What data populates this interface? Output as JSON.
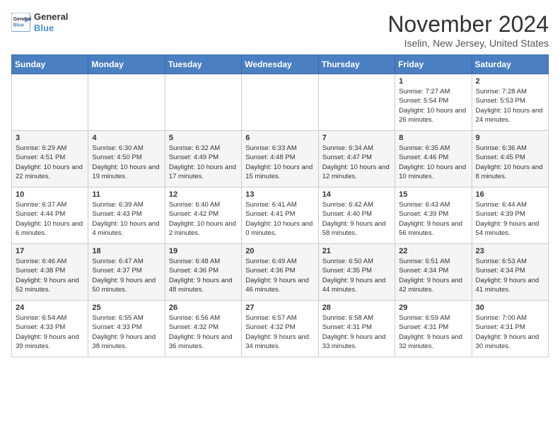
{
  "logo": {
    "line1": "General",
    "line2": "Blue"
  },
  "header": {
    "month": "November 2024",
    "location": "Iselin, New Jersey, United States"
  },
  "weekdays": [
    "Sunday",
    "Monday",
    "Tuesday",
    "Wednesday",
    "Thursday",
    "Friday",
    "Saturday"
  ],
  "weeks": [
    [
      {
        "day": "",
        "info": ""
      },
      {
        "day": "",
        "info": ""
      },
      {
        "day": "",
        "info": ""
      },
      {
        "day": "",
        "info": ""
      },
      {
        "day": "",
        "info": ""
      },
      {
        "day": "1",
        "info": "Sunrise: 7:27 AM\nSunset: 5:54 PM\nDaylight: 10 hours and 26 minutes."
      },
      {
        "day": "2",
        "info": "Sunrise: 7:28 AM\nSunset: 5:53 PM\nDaylight: 10 hours and 24 minutes."
      }
    ],
    [
      {
        "day": "3",
        "info": "Sunrise: 6:29 AM\nSunset: 4:51 PM\nDaylight: 10 hours and 22 minutes."
      },
      {
        "day": "4",
        "info": "Sunrise: 6:30 AM\nSunset: 4:50 PM\nDaylight: 10 hours and 19 minutes."
      },
      {
        "day": "5",
        "info": "Sunrise: 6:32 AM\nSunset: 4:49 PM\nDaylight: 10 hours and 17 minutes."
      },
      {
        "day": "6",
        "info": "Sunrise: 6:33 AM\nSunset: 4:48 PM\nDaylight: 10 hours and 15 minutes."
      },
      {
        "day": "7",
        "info": "Sunrise: 6:34 AM\nSunset: 4:47 PM\nDaylight: 10 hours and 12 minutes."
      },
      {
        "day": "8",
        "info": "Sunrise: 6:35 AM\nSunset: 4:46 PM\nDaylight: 10 hours and 10 minutes."
      },
      {
        "day": "9",
        "info": "Sunrise: 6:36 AM\nSunset: 4:45 PM\nDaylight: 10 hours and 8 minutes."
      }
    ],
    [
      {
        "day": "10",
        "info": "Sunrise: 6:37 AM\nSunset: 4:44 PM\nDaylight: 10 hours and 6 minutes."
      },
      {
        "day": "11",
        "info": "Sunrise: 6:39 AM\nSunset: 4:43 PM\nDaylight: 10 hours and 4 minutes."
      },
      {
        "day": "12",
        "info": "Sunrise: 6:40 AM\nSunset: 4:42 PM\nDaylight: 10 hours and 2 minutes."
      },
      {
        "day": "13",
        "info": "Sunrise: 6:41 AM\nSunset: 4:41 PM\nDaylight: 10 hours and 0 minutes."
      },
      {
        "day": "14",
        "info": "Sunrise: 6:42 AM\nSunset: 4:40 PM\nDaylight: 9 hours and 58 minutes."
      },
      {
        "day": "15",
        "info": "Sunrise: 6:43 AM\nSunset: 4:39 PM\nDaylight: 9 hours and 56 minutes."
      },
      {
        "day": "16",
        "info": "Sunrise: 6:44 AM\nSunset: 4:39 PM\nDaylight: 9 hours and 54 minutes."
      }
    ],
    [
      {
        "day": "17",
        "info": "Sunrise: 6:46 AM\nSunset: 4:38 PM\nDaylight: 9 hours and 52 minutes."
      },
      {
        "day": "18",
        "info": "Sunrise: 6:47 AM\nSunset: 4:37 PM\nDaylight: 9 hours and 50 minutes."
      },
      {
        "day": "19",
        "info": "Sunrise: 6:48 AM\nSunset: 4:36 PM\nDaylight: 9 hours and 48 minutes."
      },
      {
        "day": "20",
        "info": "Sunrise: 6:49 AM\nSunset: 4:36 PM\nDaylight: 9 hours and 46 minutes."
      },
      {
        "day": "21",
        "info": "Sunrise: 6:50 AM\nSunset: 4:35 PM\nDaylight: 9 hours and 44 minutes."
      },
      {
        "day": "22",
        "info": "Sunrise: 6:51 AM\nSunset: 4:34 PM\nDaylight: 9 hours and 42 minutes."
      },
      {
        "day": "23",
        "info": "Sunrise: 6:53 AM\nSunset: 4:34 PM\nDaylight: 9 hours and 41 minutes."
      }
    ],
    [
      {
        "day": "24",
        "info": "Sunrise: 6:54 AM\nSunset: 4:33 PM\nDaylight: 9 hours and 39 minutes."
      },
      {
        "day": "25",
        "info": "Sunrise: 6:55 AM\nSunset: 4:33 PM\nDaylight: 9 hours and 38 minutes."
      },
      {
        "day": "26",
        "info": "Sunrise: 6:56 AM\nSunset: 4:32 PM\nDaylight: 9 hours and 36 minutes."
      },
      {
        "day": "27",
        "info": "Sunrise: 6:57 AM\nSunset: 4:32 PM\nDaylight: 9 hours and 34 minutes."
      },
      {
        "day": "28",
        "info": "Sunrise: 6:58 AM\nSunset: 4:31 PM\nDaylight: 9 hours and 33 minutes."
      },
      {
        "day": "29",
        "info": "Sunrise: 6:59 AM\nSunset: 4:31 PM\nDaylight: 9 hours and 32 minutes."
      },
      {
        "day": "30",
        "info": "Sunrise: 7:00 AM\nSunset: 4:31 PM\nDaylight: 9 hours and 30 minutes."
      }
    ]
  ]
}
